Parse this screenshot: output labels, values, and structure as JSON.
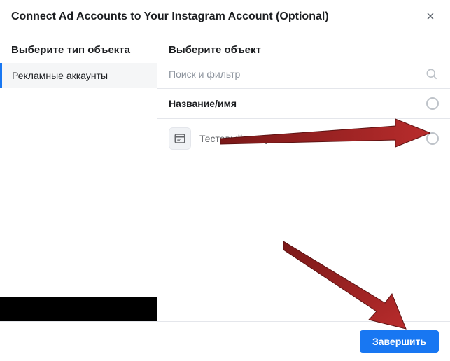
{
  "header": {
    "title": "Connect Ad Accounts to Your Instagram Account (Optional)"
  },
  "sidebar": {
    "title": "Выберите тип объекта",
    "items": [
      {
        "label": "Рекламные аккаунты",
        "active": true
      }
    ]
  },
  "main": {
    "title": "Выберите объект",
    "search_placeholder": "Поиск и фильтр",
    "column_header": "Название/имя",
    "rows": [
      {
        "label": "Тестовый аккаунт 2"
      }
    ]
  },
  "footer": {
    "primary_label": "Завершить"
  },
  "colors": {
    "accent": "#1877f2",
    "arrow": "#a22020"
  }
}
